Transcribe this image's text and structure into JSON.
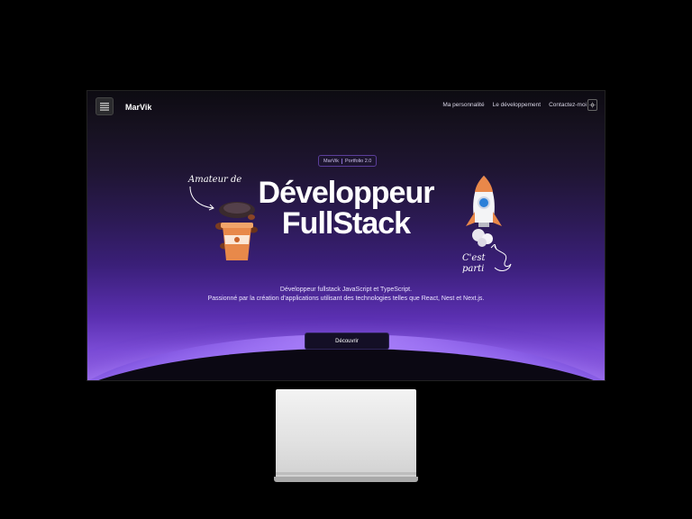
{
  "nav": {
    "brand": "MarVik",
    "links": [
      "Ma personnalité",
      "Le développement",
      "Contactez-moi"
    ]
  },
  "hero": {
    "pill_left": "MarVik",
    "pill_right": "Portfolio 2.0",
    "title_line1": "Développeur",
    "title_line2": "FullStack",
    "left_note": "Amateur de",
    "right_note_line1": "C'est",
    "right_note_line2": "parti",
    "desc_line1": "Développeur fullstack JavaScript et TypeScript.",
    "desc_line2": "Passionné par la création d'applications utilisant des technologies telles que React, Nest et Next.js.",
    "cta": "Découvrir"
  },
  "icons": {
    "logo": "logo-icon",
    "theme_toggle": "sun-icon",
    "coffee": "coffee-cup-illustration",
    "rocket": "rocket-illustration"
  },
  "colors": {
    "accent": "#7b4cd6",
    "background": "#0d0b12"
  }
}
